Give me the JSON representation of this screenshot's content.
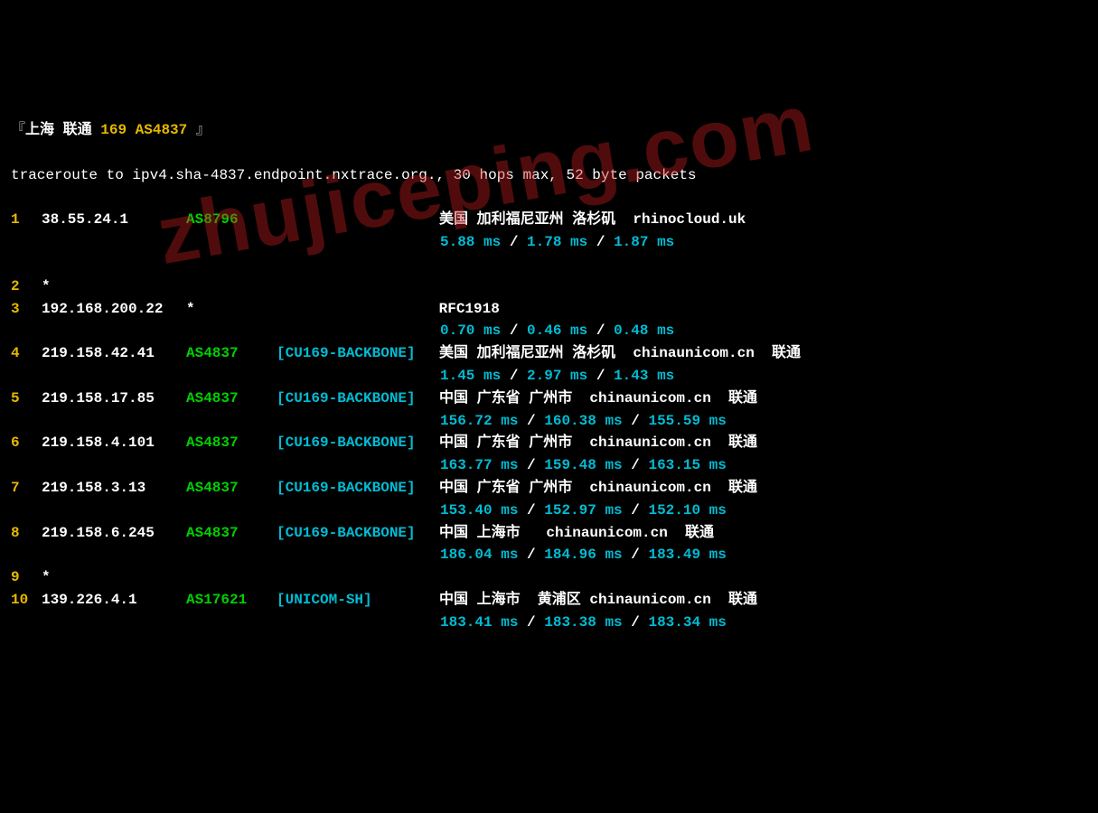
{
  "header": {
    "bracket_open": "『",
    "location": "上海 联通",
    "asn": "169 AS4837",
    "bracket_close": "』"
  },
  "cmdline": "traceroute to ipv4.sha-4837.endpoint.nxtrace.org., 30 hops max, 52 byte packets",
  "hops": [
    {
      "n": "1",
      "ip": "38.55.24.1",
      "asn": "AS8796",
      "tag": "",
      "loc": "美国 加利福尼亚州 洛杉矶  rhinocloud.uk",
      "lat": [
        "5.88 ms",
        "1.78 ms",
        "1.87 ms"
      ],
      "blank_after": true
    },
    {
      "n": "2",
      "ip": "*",
      "asn": "",
      "tag": "",
      "loc": "",
      "lat": null
    },
    {
      "n": "3",
      "ip": "192.168.200.22",
      "asn": "*",
      "tag": "",
      "loc": "RFC1918",
      "loc_is_rfc": true,
      "lat": [
        "0.70 ms",
        "0.46 ms",
        "0.48 ms"
      ]
    },
    {
      "n": "4",
      "ip": "219.158.42.41",
      "asn": "AS4837",
      "tag": "[CU169-BACKBONE]",
      "loc": "美国 加利福尼亚州 洛杉矶  chinaunicom.cn  联通",
      "lat": [
        "1.45 ms",
        "2.97 ms",
        "1.43 ms"
      ]
    },
    {
      "n": "5",
      "ip": "219.158.17.85",
      "asn": "AS4837",
      "tag": "[CU169-BACKBONE]",
      "loc": "中国 广东省 广州市  chinaunicom.cn  联通",
      "lat": [
        "156.72 ms",
        "160.38 ms",
        "155.59 ms"
      ]
    },
    {
      "n": "6",
      "ip": "219.158.4.101",
      "asn": "AS4837",
      "tag": "[CU169-BACKBONE]",
      "loc": "中国 广东省 广州市  chinaunicom.cn  联通",
      "lat": [
        "163.77 ms",
        "159.48 ms",
        "163.15 ms"
      ]
    },
    {
      "n": "7",
      "ip": "219.158.3.13",
      "asn": "AS4837",
      "tag": "[CU169-BACKBONE]",
      "loc": "中国 广东省 广州市  chinaunicom.cn  联通",
      "lat": [
        "153.40 ms",
        "152.97 ms",
        "152.10 ms"
      ]
    },
    {
      "n": "8",
      "ip": "219.158.6.245",
      "asn": "AS4837",
      "tag": "[CU169-BACKBONE]",
      "loc": "中国 上海市   chinaunicom.cn  联通",
      "lat": [
        "186.04 ms",
        "184.96 ms",
        "183.49 ms"
      ]
    },
    {
      "n": "9",
      "ip": "*",
      "asn": "",
      "tag": "",
      "loc": "",
      "lat": null
    },
    {
      "n": "10",
      "ip": "139.226.4.1",
      "asn": "AS17621",
      "tag": "[UNICOM-SH]",
      "loc": "中国 上海市  黄浦区 chinaunicom.cn  联通",
      "lat": [
        "183.41 ms",
        "183.38 ms",
        "183.34 ms"
      ]
    }
  ],
  "watermark": "zhujiceping.com"
}
